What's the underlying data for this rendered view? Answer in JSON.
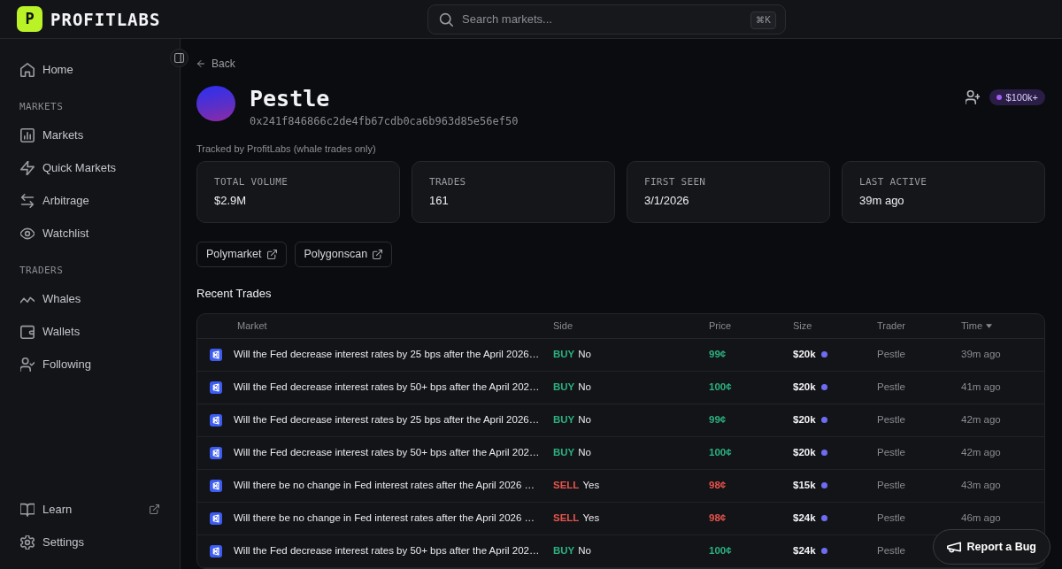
{
  "brand": {
    "logo_letter": "P",
    "name": "PROFITLABS"
  },
  "search": {
    "placeholder": "Search markets...",
    "shortcut": "⌘K"
  },
  "sidebar": {
    "sections": [
      {
        "items": [
          {
            "label": "Home"
          }
        ]
      },
      {
        "title": "MARKETS",
        "items": [
          {
            "label": "Markets"
          },
          {
            "label": "Quick Markets"
          },
          {
            "label": "Arbitrage"
          },
          {
            "label": "Watchlist"
          }
        ]
      },
      {
        "title": "TRADERS",
        "items": [
          {
            "label": "Whales"
          },
          {
            "label": "Wallets"
          },
          {
            "label": "Following"
          }
        ]
      }
    ],
    "footer_items": [
      {
        "label": "Learn",
        "external": true
      },
      {
        "label": "Settings",
        "external": false
      }
    ]
  },
  "profile": {
    "back": "Back",
    "name": "Pestle",
    "address": "0x241f846866c2de4fb67cdb0ca6b963d85e56ef50",
    "tier": "$100k+",
    "note": "Tracked by ProfitLabs (whale trades only)"
  },
  "stats": [
    {
      "label": "TOTAL VOLUME",
      "value": "$2.9M"
    },
    {
      "label": "TRADES",
      "value": "161"
    },
    {
      "label": "FIRST SEEN",
      "value": "3/1/2026"
    },
    {
      "label": "LAST ACTIVE",
      "value": "39m ago"
    }
  ],
  "links": [
    {
      "label": "Polymarket"
    },
    {
      "label": "Polygonscan"
    }
  ],
  "recent_trades": {
    "title": "Recent Trades",
    "columns": [
      {
        "label": "Market",
        "sorted": false
      },
      {
        "label": "Side",
        "sorted": false
      },
      {
        "label": "Price",
        "sorted": false
      },
      {
        "label": "Size",
        "sorted": false
      },
      {
        "label": "Trader",
        "sorted": false
      },
      {
        "label": "Time",
        "sorted": true
      }
    ],
    "rows": [
      {
        "market": "Will the Fed decrease interest rates by 25 bps after the April 2026…",
        "kind": "buy",
        "action": "BUY",
        "outcome": "No",
        "price": "99¢",
        "size": "$20k",
        "trader": "Pestle",
        "time": "39m ago"
      },
      {
        "market": "Will the Fed decrease interest rates by 50+ bps after the April 202…",
        "kind": "buy",
        "action": "BUY",
        "outcome": "No",
        "price": "100¢",
        "size": "$20k",
        "trader": "Pestle",
        "time": "41m ago"
      },
      {
        "market": "Will the Fed decrease interest rates by 25 bps after the April 2026…",
        "kind": "buy",
        "action": "BUY",
        "outcome": "No",
        "price": "99¢",
        "size": "$20k",
        "trader": "Pestle",
        "time": "42m ago"
      },
      {
        "market": "Will the Fed decrease interest rates by 50+ bps after the April 202…",
        "kind": "buy",
        "action": "BUY",
        "outcome": "No",
        "price": "100¢",
        "size": "$20k",
        "trader": "Pestle",
        "time": "42m ago"
      },
      {
        "market": "Will there be no change in Fed interest rates after the April 2026 …",
        "kind": "sell",
        "action": "SELL",
        "outcome": "Yes",
        "price": "98¢",
        "size": "$15k",
        "trader": "Pestle",
        "time": "43m ago"
      },
      {
        "market": "Will there be no change in Fed interest rates after the April 2026 …",
        "kind": "sell",
        "action": "SELL",
        "outcome": "Yes",
        "price": "98¢",
        "size": "$24k",
        "trader": "Pestle",
        "time": "46m ago"
      },
      {
        "market": "Will the Fed decrease interest rates by 50+ bps after the April 202…",
        "kind": "buy",
        "action": "BUY",
        "outcome": "No",
        "price": "100¢",
        "size": "$24k",
        "trader": "Pestle"
      }
    ]
  },
  "report_bug": {
    "label": "Report a Bug"
  }
}
